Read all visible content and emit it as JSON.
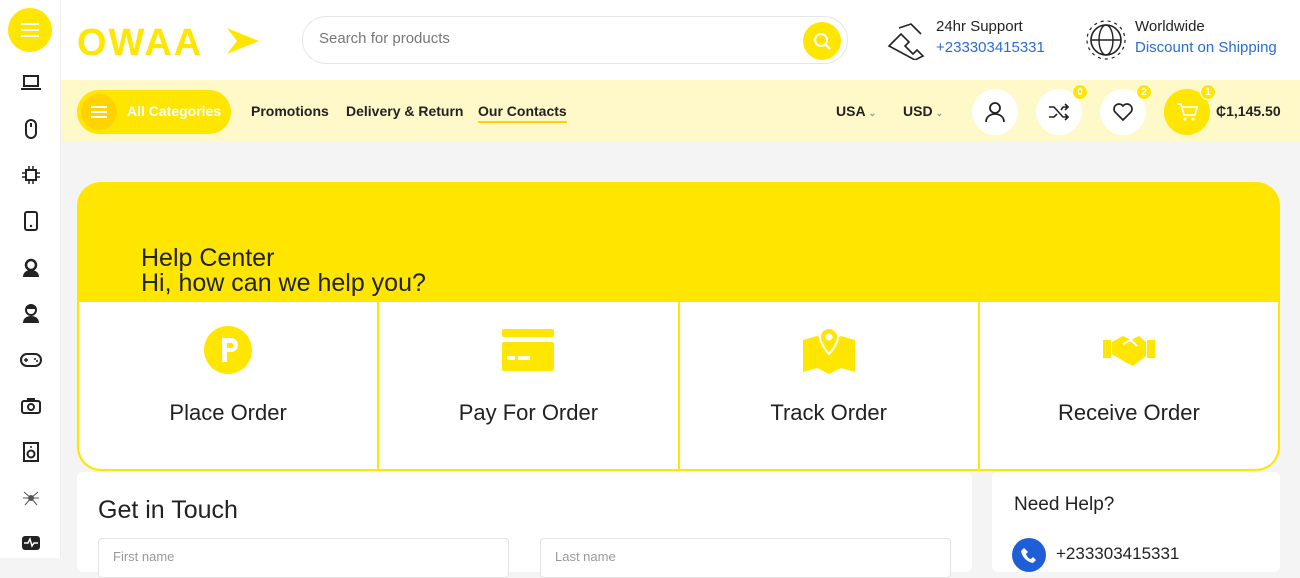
{
  "brand": {
    "logo_text": "OWAA"
  },
  "search": {
    "placeholder": "Search for products"
  },
  "support": {
    "title": "24hr Support",
    "phone": "+233303415331"
  },
  "shipping": {
    "title": "Worldwide",
    "subtitle": "Discount on Shipping"
  },
  "nav": {
    "all_categories": "All Categories",
    "links": [
      "Promotions",
      "Delivery & Return",
      "Our Contacts"
    ],
    "country": "USA",
    "currency": "USD",
    "compare_count": "0",
    "wishlist_count": "2",
    "cart_count": "1",
    "cart_total": "₵1,145.50"
  },
  "sidebar": {
    "icons": [
      "laptop-icon",
      "mouse-icon",
      "cpu-icon",
      "phone-icon",
      "woman-user-icon",
      "man-user-icon",
      "gamepad-icon",
      "camera-icon",
      "speaker-icon",
      "spider-icon",
      "monitor-heartbeat-icon"
    ]
  },
  "hero": {
    "title": "Help Center",
    "subtitle": "Hi, how can we help you?",
    "cards": [
      {
        "label": "Place Order",
        "icon": "parking-p-icon"
      },
      {
        "label": "Pay For Order",
        "icon": "credit-card-icon"
      },
      {
        "label": "Track Order",
        "icon": "map-pin-icon"
      },
      {
        "label": "Receive Order",
        "icon": "handshake-icon"
      }
    ]
  },
  "contact": {
    "title": "Get in Touch",
    "first_name_placeholder": "First name",
    "last_name_placeholder": "Last name"
  },
  "help": {
    "title": "Need Help?",
    "phone": "+233303415331"
  },
  "colors": {
    "accent": "#ffe600",
    "link": "#2a6cd6",
    "navbar_bg": "#fff8c8"
  }
}
